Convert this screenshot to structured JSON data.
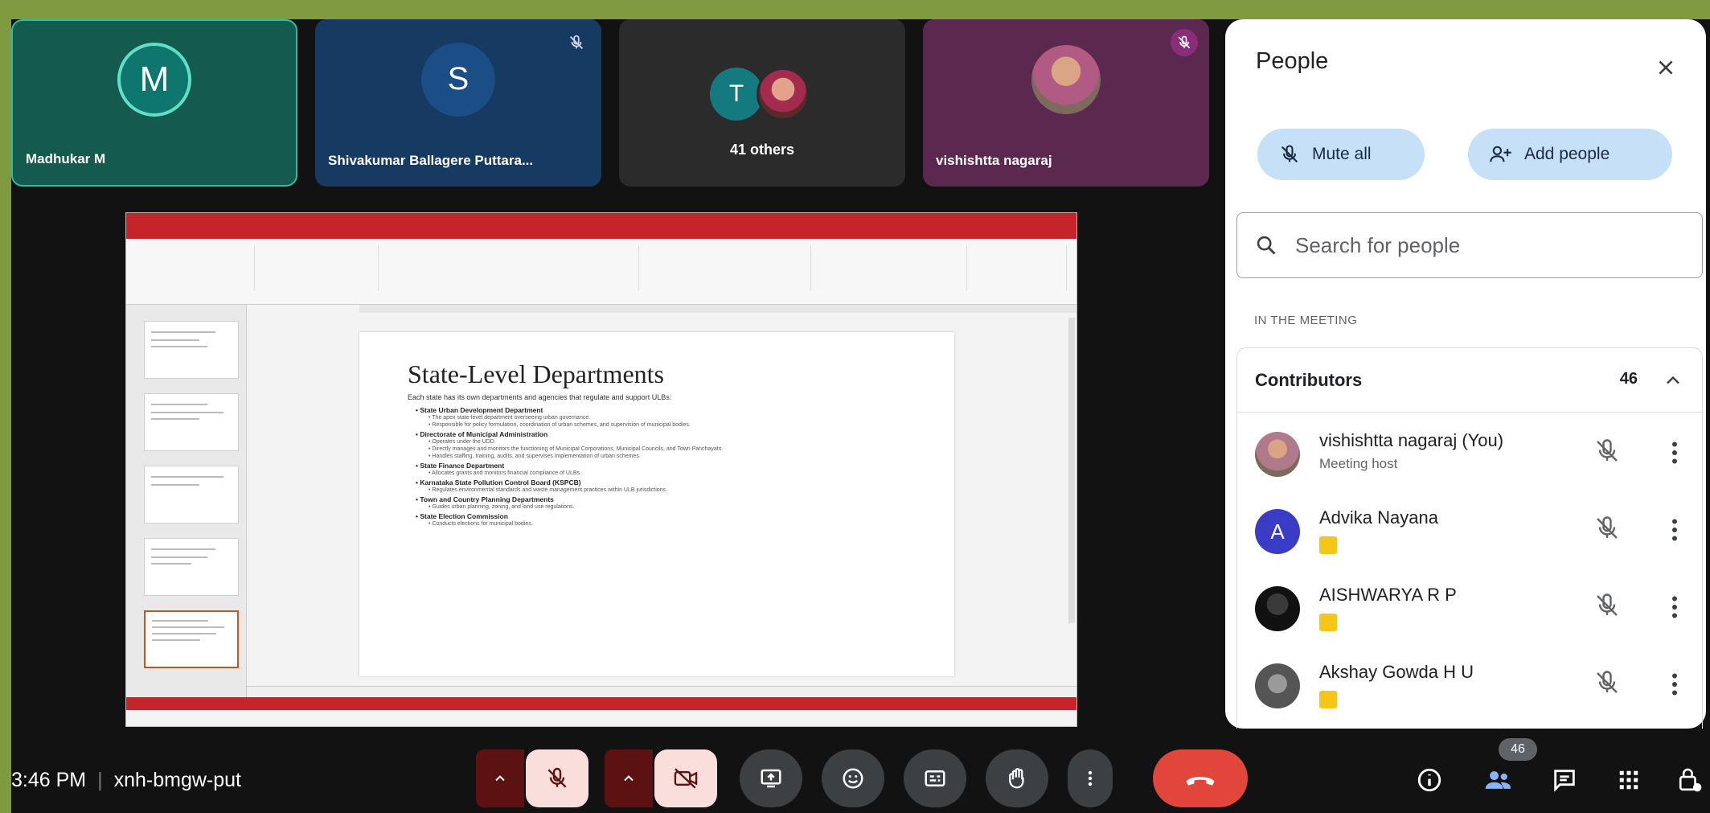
{
  "tiles": [
    {
      "initial": "M",
      "name": "Madhukar M"
    },
    {
      "initial": "S",
      "name": "Shivakumar Ballagere Puttara..."
    },
    {
      "initial": "T",
      "caption": "41 others"
    },
    {
      "name": "vishishtta nagaraj"
    }
  ],
  "slide": {
    "title": "State-Level Departments",
    "intro": "Each state has its own departments and agencies that regulate and support ULBs:",
    "items": [
      {
        "head": "State Urban Development Department",
        "subs": [
          "The apex state-level department overseeing urban governance.",
          "Responsible for policy formulation, coordination of urban schemes, and supervision of municipal bodies."
        ]
      },
      {
        "head": "Directorate of Municipal Administration",
        "subs": [
          "Operates under the UDD.",
          "Directly manages and monitors the functioning of Municipal Corporations, Municipal Councils, and Town Panchayats.",
          "Handles staffing, training, audits, and supervises implementation of urban schemes."
        ]
      },
      {
        "head": "State Finance Department",
        "subs": [
          "Allocates grants and monitors financial compliance of ULBs."
        ]
      },
      {
        "head": "Karnataka State Pollution Control Board (KSPCB)",
        "subs": [
          "Regulates environmental standards and waste management practices within ULB jurisdictions."
        ]
      },
      {
        "head": "Town and Country Planning Departments",
        "subs": [
          "Guides urban planning, zoning, and land use regulations."
        ]
      },
      {
        "head": "State Election Commission",
        "subs": [
          "Conducts elections for municipal bodies."
        ]
      }
    ]
  },
  "panel": {
    "title": "People",
    "mute_all": "Mute all",
    "add_people": "Add people",
    "search_placeholder": "Search for people",
    "section": "IN THE MEETING",
    "group_label": "Contributors",
    "group_count": "46",
    "people": [
      {
        "name": "vishishtta nagaraj (You)",
        "sub": "Meeting host",
        "avatar_color": "#b07a8c"
      },
      {
        "name": "Advika Nayana",
        "initial": "A",
        "avatar_color": "#3b3cc6"
      },
      {
        "name": "AISHWARYA R P",
        "avatar_color": "#1e1e1e"
      },
      {
        "name": "Akshay Gowda H U",
        "avatar_color": "#555555"
      }
    ]
  },
  "bottom": {
    "time": "3:46 PM",
    "meeting_code": "xnh-bmgw-put",
    "people_count": "46"
  },
  "colors": {
    "accent_pill": "#c6e0f7",
    "end_call": "#e2463a",
    "mic_off_bg": "#f9dedc"
  }
}
